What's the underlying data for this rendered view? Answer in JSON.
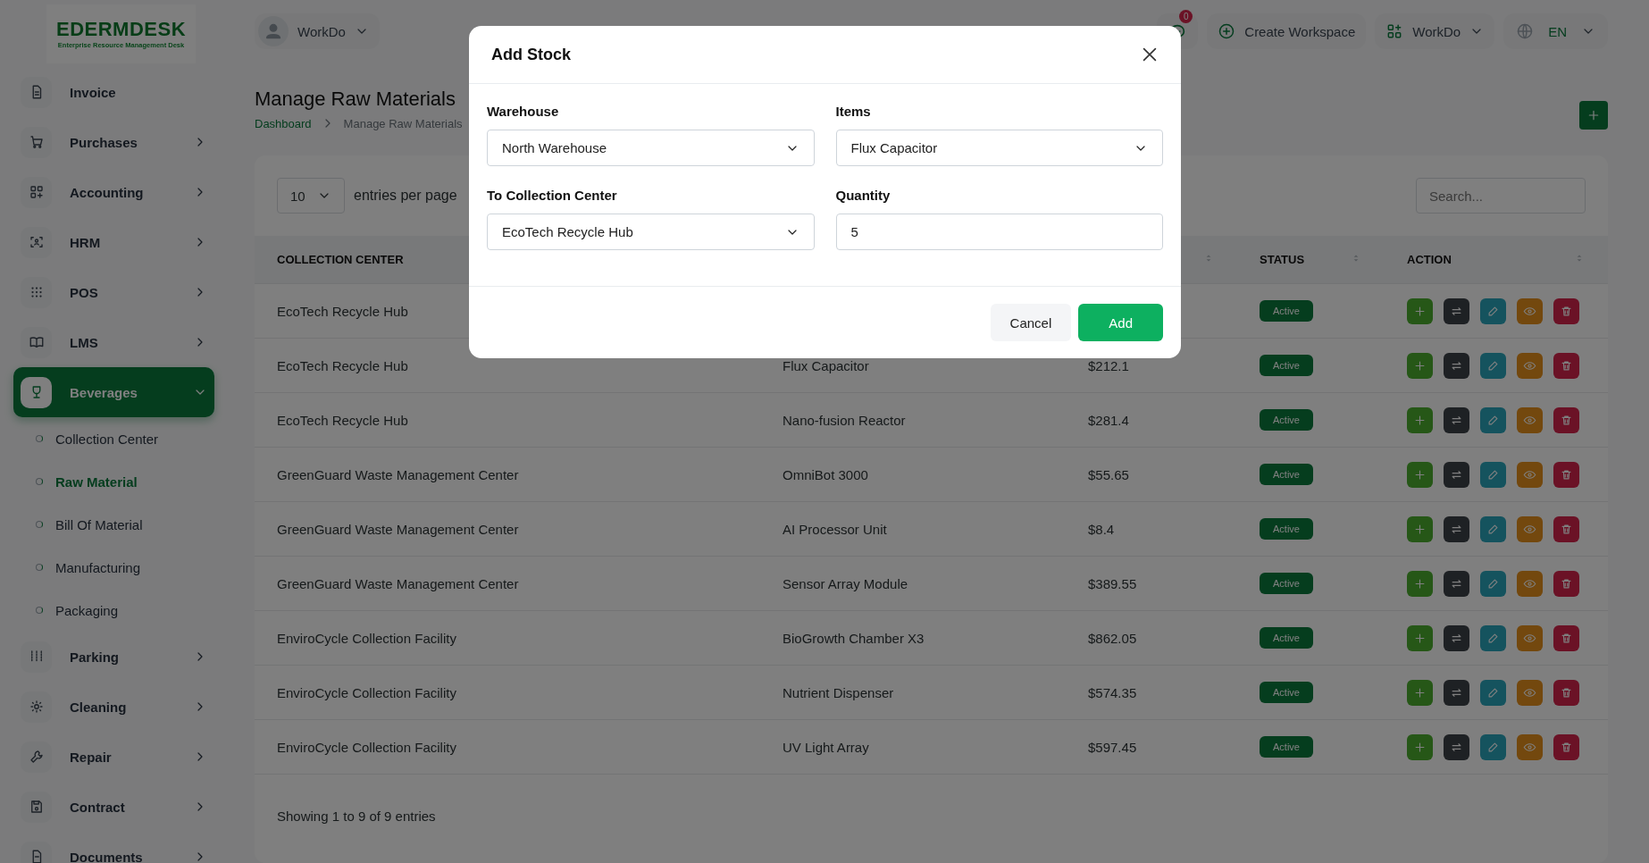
{
  "logo": {
    "title": "EDERMDESK",
    "subtitle": "Enterprise Resource Management Desk"
  },
  "sidebar": {
    "items": [
      {
        "label": "Invoice",
        "has_submenu": false,
        "selected": false
      },
      {
        "label": "Purchases",
        "has_submenu": true,
        "expanded": false,
        "selected": false
      },
      {
        "label": "Accounting",
        "has_submenu": true,
        "expanded": false,
        "selected": false
      },
      {
        "label": "HRM",
        "has_submenu": true,
        "expanded": false,
        "selected": false
      },
      {
        "label": "POS",
        "has_submenu": true,
        "expanded": false,
        "selected": false
      },
      {
        "label": "LMS",
        "has_submenu": true,
        "expanded": false,
        "selected": false
      },
      {
        "label": "Beverages",
        "has_submenu": true,
        "expanded": true,
        "selected": true,
        "children": [
          {
            "label": "Collection Center",
            "selected": false
          },
          {
            "label": "Raw Material",
            "selected": true
          },
          {
            "label": "Bill Of Material",
            "selected": false
          },
          {
            "label": "Manufacturing",
            "selected": false
          },
          {
            "label": "Packaging",
            "selected": false
          }
        ]
      },
      {
        "label": "Parking",
        "has_submenu": true,
        "expanded": false,
        "selected": false
      },
      {
        "label": "Cleaning",
        "has_submenu": true,
        "expanded": false,
        "selected": false
      },
      {
        "label": "Repair",
        "has_submenu": true,
        "expanded": false,
        "selected": false
      },
      {
        "label": "Contract",
        "has_submenu": true,
        "expanded": false,
        "selected": false
      },
      {
        "label": "Documents",
        "has_submenu": true,
        "expanded": false,
        "selected": false
      }
    ]
  },
  "header": {
    "user_menu": "WorkDo",
    "chat_badge": "0",
    "create_workspace": "Create Workspace",
    "workspace_menu": "WorkDo",
    "language": "EN"
  },
  "page": {
    "title": "Manage Raw Materials",
    "breadcrumb": [
      "Dashboard",
      "Manage Raw Materials"
    ]
  },
  "table": {
    "entries_value": "10",
    "entries_label": "entries per page",
    "search": {
      "placeholder": "Search..."
    },
    "columns": [
      {
        "label": "COLLECTION CENTER"
      },
      {},
      {
        "sortable": true
      },
      {
        "label": "STATUS",
        "sortable": true
      },
      {
        "label": "ACTION",
        "sortable": true
      }
    ],
    "rows": [
      {
        "collection_center": "EcoTech Recycle Hub",
        "status": "Active"
      },
      {
        "collection_center": "EcoTech Recycle Hub",
        "item": "Flux Capacitor",
        "price": "$212.1",
        "status": "Active"
      },
      {
        "collection_center": "EcoTech Recycle Hub",
        "item": "Nano-fusion Reactor",
        "price": "$281.4",
        "status": "Active"
      },
      {
        "collection_center": "GreenGuard Waste Management Center",
        "item": "OmniBot 3000",
        "price": "$55.65",
        "status": "Active"
      },
      {
        "collection_center": "GreenGuard Waste Management Center",
        "item": "AI Processor Unit",
        "price": "$8.4",
        "status": "Active"
      },
      {
        "collection_center": "GreenGuard Waste Management Center",
        "item": "Sensor Array Module",
        "price": "$389.55",
        "status": "Active"
      },
      {
        "collection_center": "EnviroCycle Collection Facility",
        "item": "BioGrowth Chamber X3",
        "price": "$862.05",
        "status": "Active"
      },
      {
        "collection_center": "EnviroCycle Collection Facility",
        "item": "Nutrient Dispenser",
        "price": "$574.35",
        "status": "Active"
      },
      {
        "collection_center": "EnviroCycle Collection Facility",
        "item": "UV Light Array",
        "price": "$597.45",
        "status": "Active"
      }
    ],
    "footer": "Showing 1 to 9 of 9 entries"
  },
  "modal": {
    "title": "Add Stock",
    "fields": [
      {
        "label": "Warehouse",
        "kind": "select",
        "value": "North Warehouse"
      },
      {
        "label": "Items",
        "kind": "select",
        "value": "Flux Capacitor"
      },
      {
        "label": "To Collection Center",
        "kind": "select",
        "value": "EcoTech Recycle Hub"
      },
      {
        "label": "Quantity",
        "kind": "input",
        "value": "5"
      }
    ],
    "buttons": [
      {
        "label": "Cancel",
        "kind": "secondary"
      },
      {
        "label": "Add",
        "kind": "primary"
      }
    ]
  }
}
